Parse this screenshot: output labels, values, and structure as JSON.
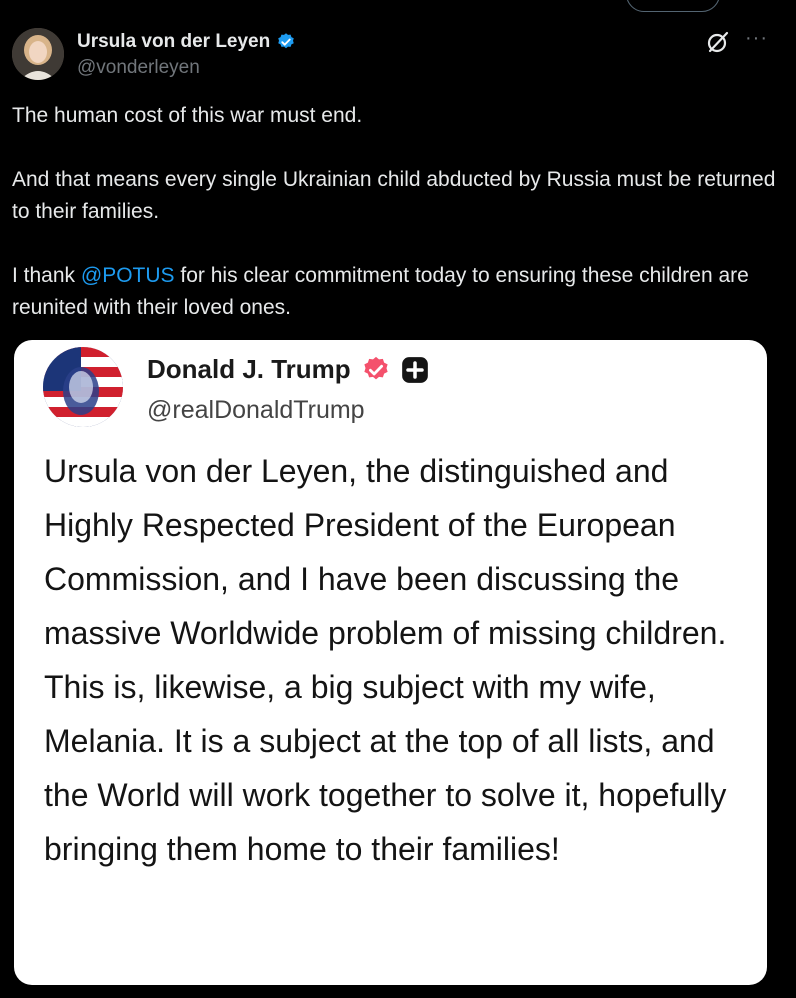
{
  "author": {
    "name": "Ursula von der Leyen",
    "handle": "@vonderleyen"
  },
  "tweet": {
    "para1": "The human cost of this war must end.",
    "para2": "And that means every single Ukrainian child abducted by Russia must be returned to their families.",
    "para3_before": "I thank ",
    "mention": "@POTUS",
    "para3_after": " for his clear commitment today to ensuring these children are reunited with their loved ones."
  },
  "quoted": {
    "name": "Donald J. Trump",
    "handle": "@realDonaldTrump",
    "text": "Ursula von der Leyen, the distinguished and Highly Respected President of the European Commission, and I have been discussing the massive Worldwide problem of missing children. This is, likewise, a big subject with my wife, Melania. It is a subject at the top of all lists, and the World will work together to solve it, hopefully bringing them home to their families!"
  },
  "icons": {
    "verified": "verified-badge-icon",
    "grok": "grok-icon",
    "more": "more-icon",
    "quoted_verified": "verified-badge-icon",
    "quoted_plus": "plus-badge-icon"
  },
  "colors": {
    "background": "#000000",
    "text": "#e7e9ea",
    "muted": "#71767b",
    "link": "#1d9bf0",
    "verified_blue": "#1d9bf0",
    "quoted_verified": "#f4516c"
  }
}
